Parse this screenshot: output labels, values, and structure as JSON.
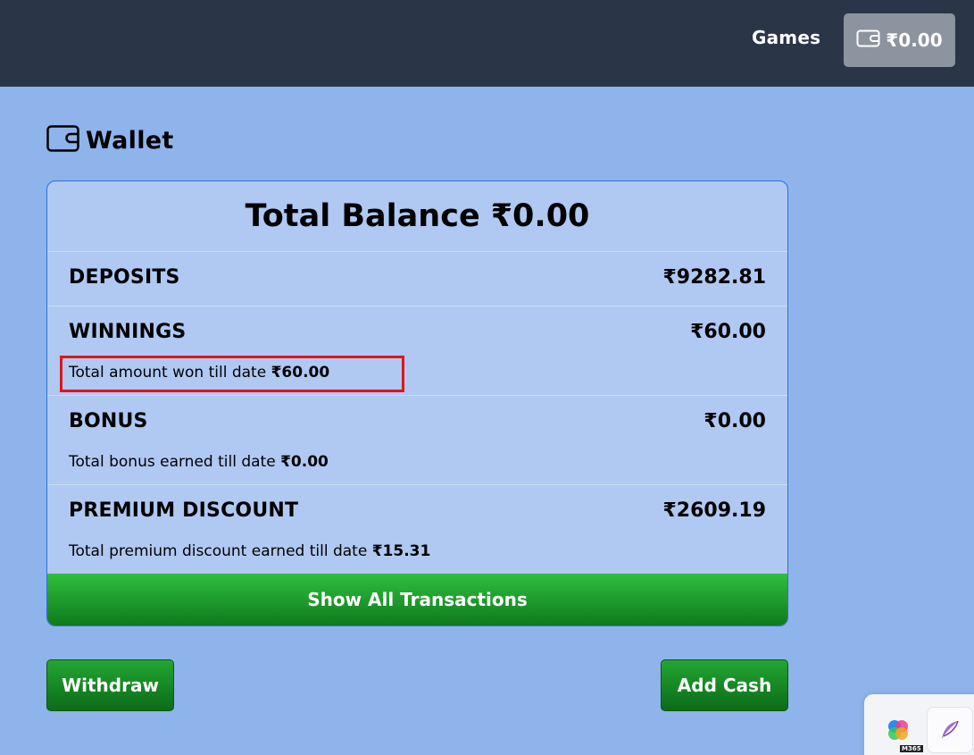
{
  "header": {
    "games_label": "Games",
    "wallet_balance": "₹0.00"
  },
  "page": {
    "title": "Wallet"
  },
  "card": {
    "total_label": "Total Balance",
    "total_value": "₹0.00",
    "sections": [
      {
        "title": "DEPOSITS",
        "amount": "₹9282.81"
      },
      {
        "title": "WINNINGS",
        "amount": "₹60.00",
        "sub_text": "Total amount won till date",
        "sub_value": "₹60.00"
      },
      {
        "title": "BONUS",
        "amount": "₹0.00",
        "sub_text": "Total bonus earned till date",
        "sub_value": "₹0.00"
      },
      {
        "title": "PREMIUM DISCOUNT",
        "amount": "₹2609.19",
        "sub_text": "Total premium discount earned till date",
        "sub_value": "₹15.31"
      }
    ],
    "show_all_label": "Show All Transactions"
  },
  "actions": {
    "withdraw_label": "Withdraw",
    "add_cash_label": "Add Cash"
  },
  "extensions": {
    "m365_badge": "M365"
  },
  "colors": {
    "topbar": "#2b3548",
    "background": "#8fb3eb",
    "card": "#b0c9f2",
    "button_green": "#1a9a2a",
    "highlight": "#e3131b"
  }
}
